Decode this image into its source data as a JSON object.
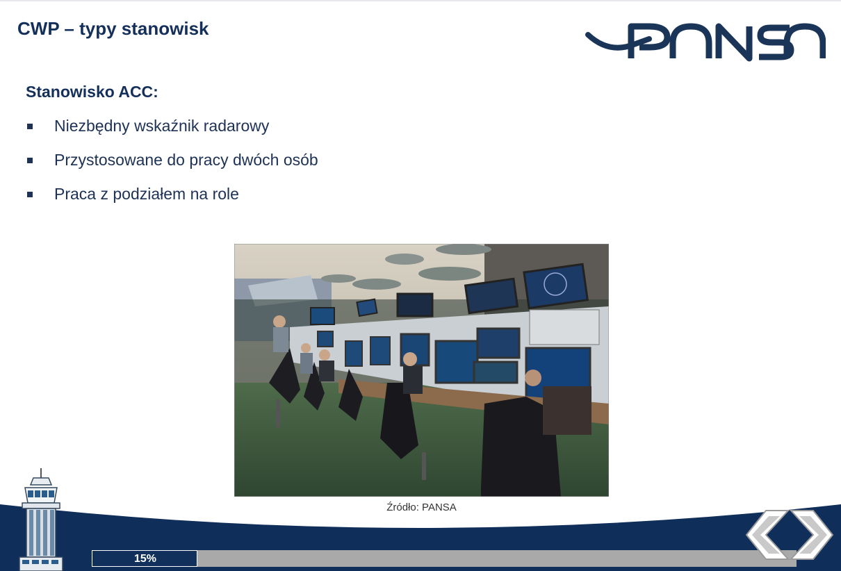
{
  "slide": {
    "title": "CWP – typy stanowisk",
    "logo_text": "PANSA"
  },
  "content": {
    "heading": "Stanowisko ACC:",
    "bullets": [
      "Niezbędny wskaźnik radarowy",
      "Przystosowane do pracy dwóch osób",
      "Praca z podziałem na role"
    ],
    "image_caption": "Źródło: PANSA"
  },
  "progress": {
    "label": "15%",
    "fraction": 0.15
  },
  "navigation": {
    "prev_icon": "chevron-left-icon",
    "next_icon": "chevron-right-icon"
  },
  "colors": {
    "brand_navy": "#14305a",
    "progress_fill": "#11315c",
    "progress_track": "#a9a9a9"
  }
}
